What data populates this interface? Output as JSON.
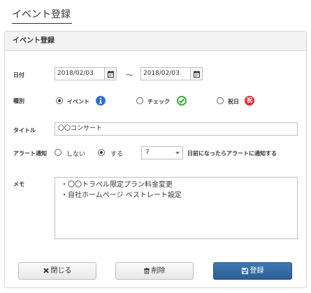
{
  "page": {
    "title": "イベント登録"
  },
  "panel": {
    "header": "イベント登録"
  },
  "form": {
    "date": {
      "label": "日付",
      "start": "2018/02/03",
      "separator": "～",
      "end": "2018/02/03"
    },
    "type": {
      "label": "種別",
      "options": [
        {
          "label": "イベント",
          "checked": true,
          "icon": "info-icon",
          "color": "#2e6fd1"
        },
        {
          "label": "チェック",
          "checked": false,
          "icon": "check-icon",
          "color": "#39a33b"
        },
        {
          "label": "祝日",
          "checked": false,
          "icon": "holiday-icon",
          "badge_text": "祝",
          "color": "#e03030"
        }
      ]
    },
    "title": {
      "label": "タイトル",
      "value": "〇〇コンサート"
    },
    "alert": {
      "label": "アラート通知",
      "options": [
        {
          "label": "しない",
          "checked": false
        },
        {
          "label": "する",
          "checked": true
        }
      ],
      "days_value": "7",
      "suffix": "日前になったらアラートに通知する"
    },
    "memo": {
      "label": "メモ",
      "lines": [
        "・〇〇トラベル限定プラン料金変更",
        "・自社ホームページ ベストレート設定"
      ]
    }
  },
  "buttons": {
    "close": "閉じる",
    "delete": "削除",
    "register": "登録",
    "primary_color": "#2d5f96"
  }
}
